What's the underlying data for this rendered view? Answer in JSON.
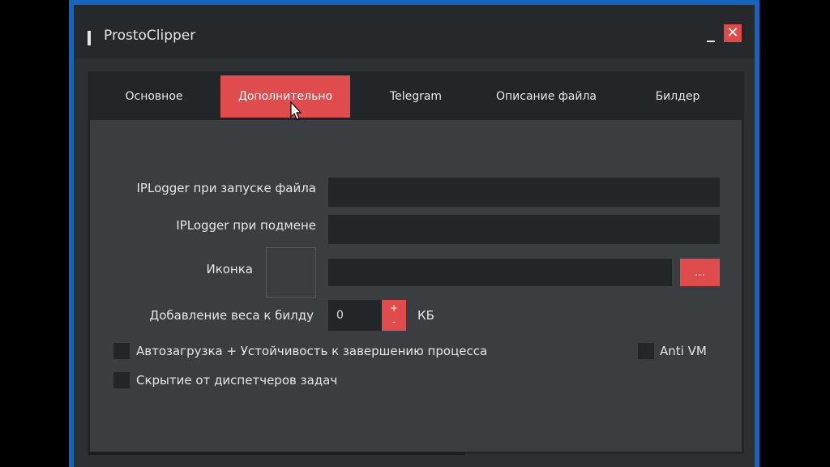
{
  "window": {
    "title": "ProstoClipper",
    "minimize_symbol": "_",
    "close_symbol": "✕"
  },
  "tabs": [
    {
      "label": "Основное",
      "active": false
    },
    {
      "label": "Дополнительно",
      "active": true
    },
    {
      "label": "Telegram",
      "active": false
    },
    {
      "label": "Описание файла",
      "active": false
    },
    {
      "label": "Билдер",
      "active": false
    }
  ],
  "form": {
    "iplogger_launch_label": "IPLogger при запуске файла",
    "iplogger_launch_value": "",
    "iplogger_replace_label": "IPLogger при подмене",
    "iplogger_replace_value": "",
    "icon_label": "Иконка",
    "icon_path_value": "",
    "browse_label": "...",
    "weight_label": "Добавление веса к билду",
    "weight_value": "0",
    "weight_plus": "+",
    "weight_minus": "-",
    "weight_unit": "КБ"
  },
  "options": {
    "autostart_label": "Автозагрузка + Устойчивость к завершению процесса",
    "autostart_checked": false,
    "antivm_label": "Anti VM",
    "antivm_checked": false,
    "hide_taskmgr_label": "Скрытие от диспетчеров задач",
    "hide_taskmgr_checked": false
  },
  "colors": {
    "accent": "#e04b4d",
    "window_border": "#1565c0",
    "background": "#3a3e41",
    "field": "#232628"
  }
}
